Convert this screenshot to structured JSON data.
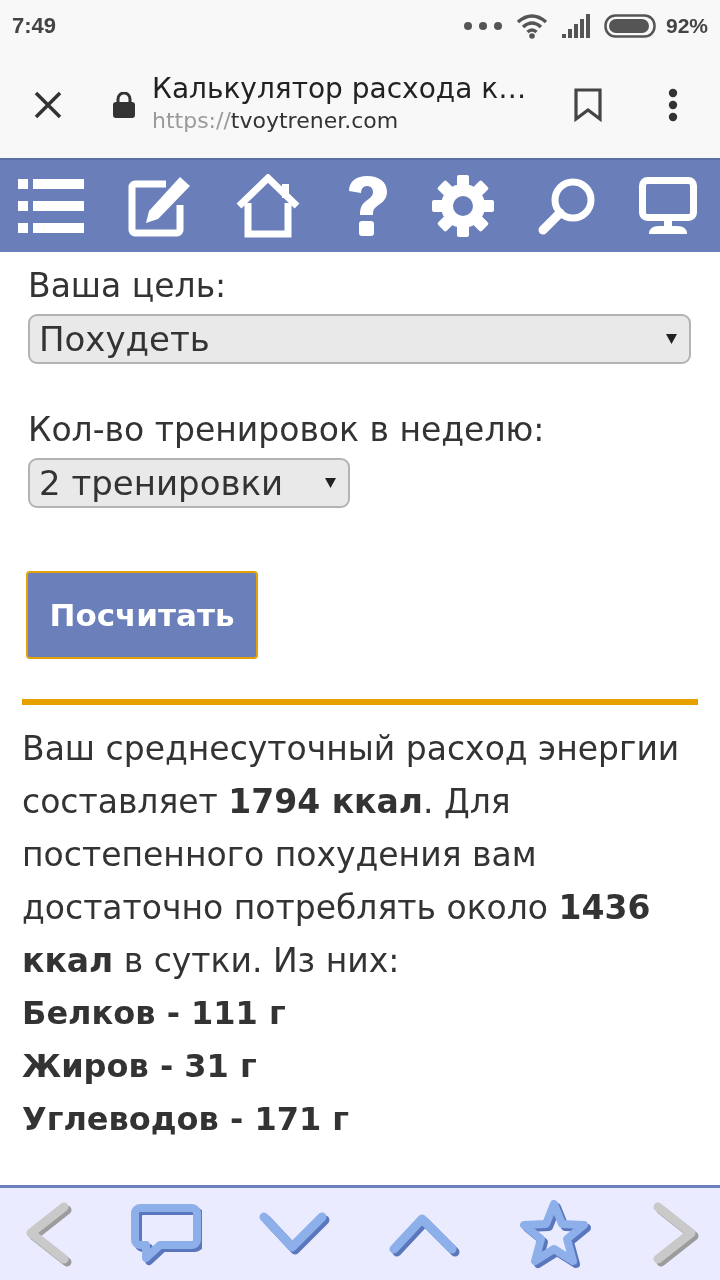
{
  "status_bar": {
    "time": "7:49",
    "battery": "92%"
  },
  "browser_bar": {
    "title": "Калькулятор расхода к…",
    "url_scheme": "https://",
    "url_host": "tvoytrener.com"
  },
  "form": {
    "fields": [
      {
        "label": "Ваша цель:",
        "value": "Похудеть"
      },
      {
        "label": "Кол-во тренировок в неделю:",
        "value": "2 тренировки"
      }
    ],
    "calculate_button": {
      "label": "Посчитать",
      "focused": true
    }
  },
  "result": {
    "text": "Ваш среднесуточный расход энергии составляет **1794 ккал**. Для постепенного похудения вам достаточно потреблять около **1436 ккал** в сутки. Из них:",
    "macros": [
      "Белков - 111 г",
      "Жиров - 31 г",
      "Углеводов - 171 г"
    ]
  },
  "bottom_nav": [
    {
      "disabled": true
    },
    {
      "disabled": false
    },
    {
      "disabled": false
    },
    {
      "disabled": false
    },
    {
      "disabled": false
    },
    {
      "disabled": true
    }
  ]
}
